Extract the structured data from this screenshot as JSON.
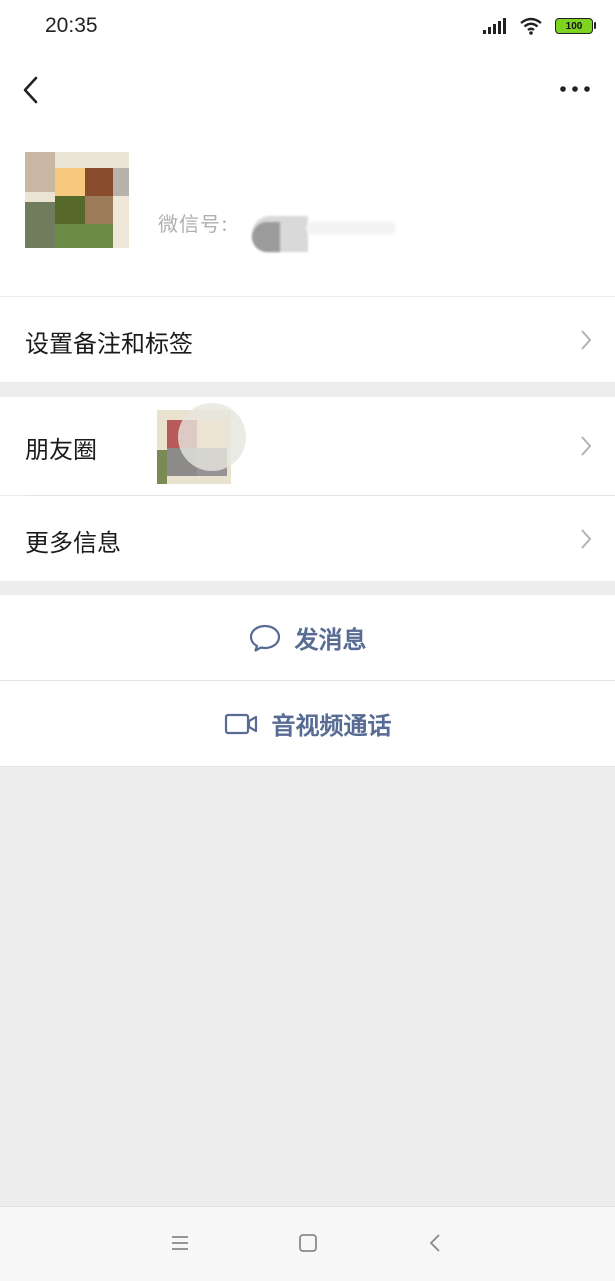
{
  "status": {
    "time": "20:35",
    "battery": "100"
  },
  "profile": {
    "wechat_id_label": "微信号: "
  },
  "menu": {
    "remark_label": "设置备注和标签",
    "moments_label": "朋友圈",
    "more_info_label": "更多信息"
  },
  "actions": {
    "send_message_label": "发消息",
    "video_call_label": "音视频通话"
  },
  "colors": {
    "accent": "#576b95",
    "background": "#ededed",
    "battery": "#7ed321"
  },
  "icons": {
    "back": "back-arrow-icon",
    "more": "more-dots-icon",
    "chevron": "chevron-right-icon",
    "message": "chat-bubble-icon",
    "video": "video-camera-icon",
    "nav_menu": "menu-icon",
    "nav_home": "home-square-icon",
    "nav_back": "nav-back-icon"
  }
}
